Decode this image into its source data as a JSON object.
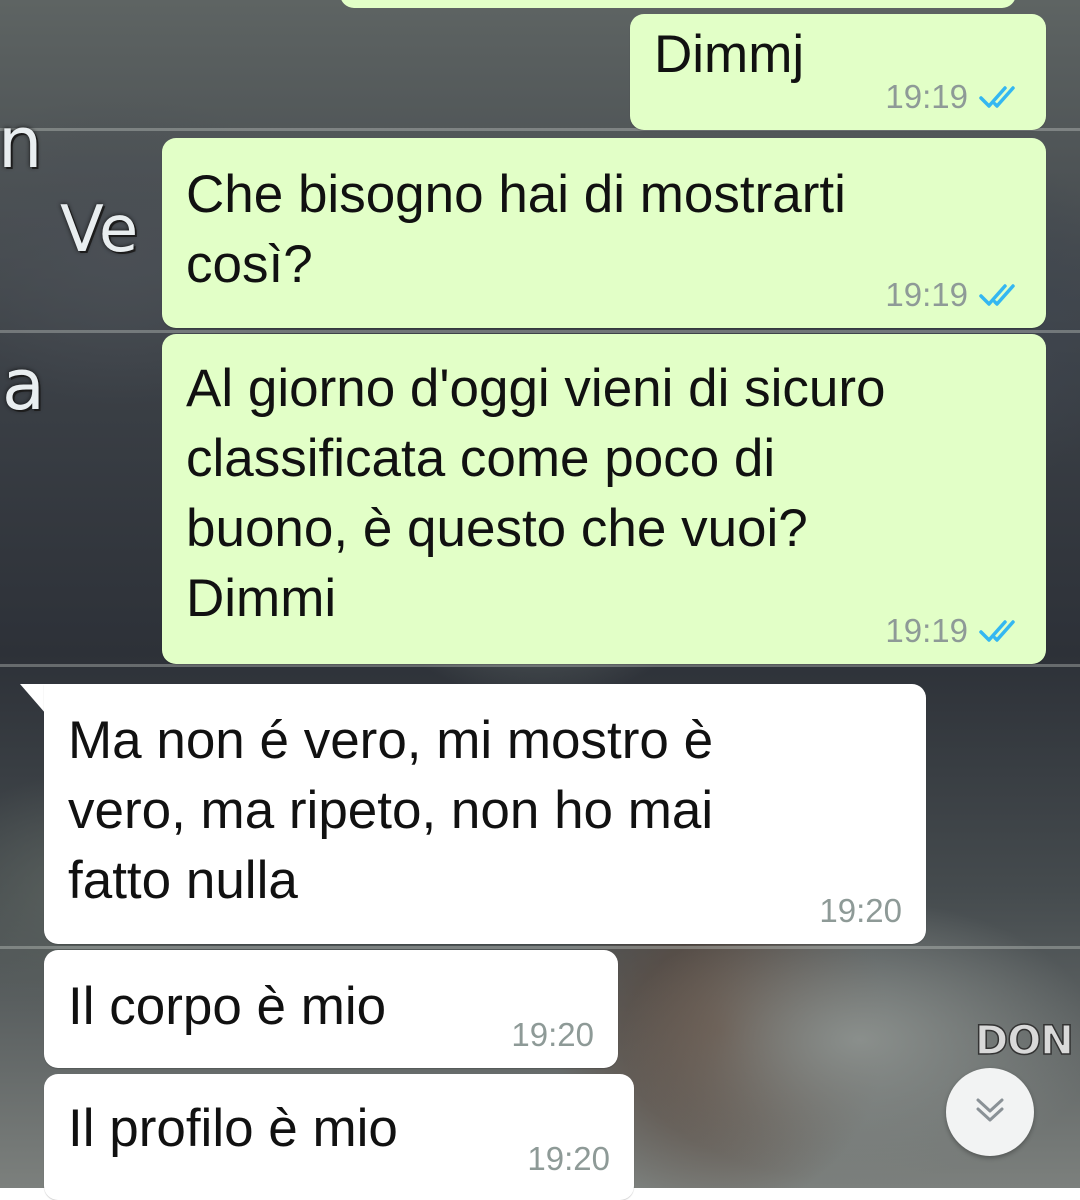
{
  "messages": [
    {
      "direction": "out",
      "text": "Dimmj",
      "time": "19:19",
      "status": "read"
    },
    {
      "direction": "out",
      "text": "Che bisogno hai di mostrarti\ncosì?",
      "time": "19:19",
      "status": "read"
    },
    {
      "direction": "out",
      "text": "Al giorno d'oggi vieni di sicuro\nclassificata come poco di\nbuono, è questo che vuoi?\nDimmi",
      "time": "19:19",
      "status": "read"
    },
    {
      "direction": "in",
      "text": "Ma non é vero, mi mostro è\nvero, ma ripeto, non ho mai\nfatto nulla",
      "time": "19:20"
    },
    {
      "direction": "in",
      "text": "Il corpo è mio",
      "time": "19:20"
    },
    {
      "direction": "in",
      "text": "Il profilo è mio",
      "time": "19:20"
    }
  ],
  "wallpaper": {
    "captions": [
      "n",
      "Ve",
      "a",
      "DON"
    ]
  },
  "colors": {
    "outgoing_bubble": "#e2ffc7",
    "incoming_bubble": "#ffffff",
    "read_tick": "#34b7f1",
    "time_text": "#8e9a97"
  },
  "icons": {
    "read_receipt": "double-check-icon",
    "scroll_down": "chevron-double-down-icon"
  }
}
